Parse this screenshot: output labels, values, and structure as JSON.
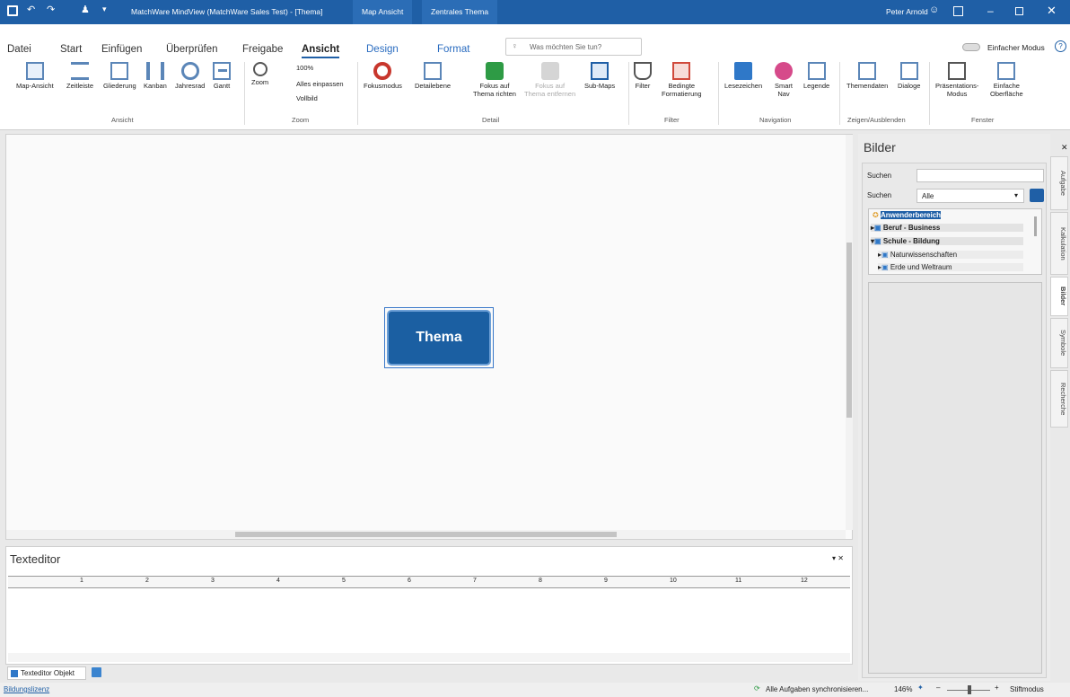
{
  "titlebar": {
    "app_title": "MatchWare MindView (MatchWare Sales Test) - [Thema]",
    "context_tab_1": "Map Ansicht",
    "context_tab_2": "Zentrales Thema",
    "user": "Peter Arnold",
    "accent": "#1f5fa6"
  },
  "menu": {
    "tabs": [
      "Datei",
      "Start",
      "Einfügen",
      "Überprüfen",
      "Freigabe",
      "Ansicht",
      "Design",
      "Format"
    ],
    "active_tab": "Ansicht",
    "tellme_placeholder": "Was möchten Sie tun?",
    "simple_mode": "Einfacher Modus"
  },
  "ribbon": {
    "ansicht": {
      "items": [
        "Map-Ansicht",
        "Zeitleiste",
        "Gliederung",
        "Kanban",
        "Jahresrad",
        "Gantt"
      ],
      "label": "Ansicht"
    },
    "zoom": {
      "zoom": "Zoom",
      "pct": "100%",
      "fit": "Alles einpassen",
      "full": "Vollbild",
      "label": "Zoom"
    },
    "detail": {
      "fokusmodus": "Fokusmodus",
      "detailebene": "Detailebene",
      "fokus_auf_1": "Fokus auf",
      "fokus_auf_2": "Thema richten",
      "fokus_weg_1": "Fokus auf",
      "fokus_weg_2": "Thema entfernen",
      "submaps": "Sub-Maps",
      "label": "Detail"
    },
    "filter": {
      "filter": "Filter",
      "bed_1": "Bedingte",
      "bed_2": "Formatierung",
      "label": "Filter"
    },
    "navigation": {
      "lesezeichen": "Lesezeichen",
      "smart_1": "Smart",
      "smart_2": "Nav",
      "legende": "Legende",
      "label": "Navigation"
    },
    "zeigen": {
      "themendaten": "Themendaten",
      "dialoge": "Dialoge",
      "label": "Zeigen/Ausblenden"
    },
    "fenster": {
      "praes_1": "Präsentations-",
      "praes_2": "Modus",
      "einf_1": "Einfache",
      "einf_2": "Oberfläche",
      "label": "Fenster"
    }
  },
  "map": {
    "central_topic": "Thema"
  },
  "texteditor": {
    "title": "Texteditor",
    "ruler_marks": [
      "1",
      "2",
      "3",
      "4",
      "5",
      "6",
      "7",
      "8",
      "9",
      "10",
      "11",
      "12"
    ],
    "tab_object": "Texteditor Objekt"
  },
  "panel": {
    "title": "Bilder",
    "search_label": "Suchen",
    "search_value": "",
    "search2_label": "Suchen",
    "filter_value": "Alle",
    "tree": [
      {
        "label": "Anwenderbereich",
        "level": 0,
        "selected": true
      },
      {
        "label": "Beruf - Business",
        "level": 0,
        "bold": true
      },
      {
        "label": "Schule - Bildung",
        "level": 0,
        "bold": true
      },
      {
        "label": "Naturwissenschaften",
        "level": 1
      },
      {
        "label": "Erde und Weltraum",
        "level": 1
      }
    ],
    "side_tabs": [
      "Aufgabe",
      "Kalkulation",
      "Bilder",
      "Symbole",
      "Recherche"
    ],
    "active_side_tab": "Bilder"
  },
  "status": {
    "license": "Bildungslizenz",
    "sync": "Alle Aufgaben synchronisieren...",
    "zoom": "146%",
    "pen_mode": "Stiftmodus"
  }
}
